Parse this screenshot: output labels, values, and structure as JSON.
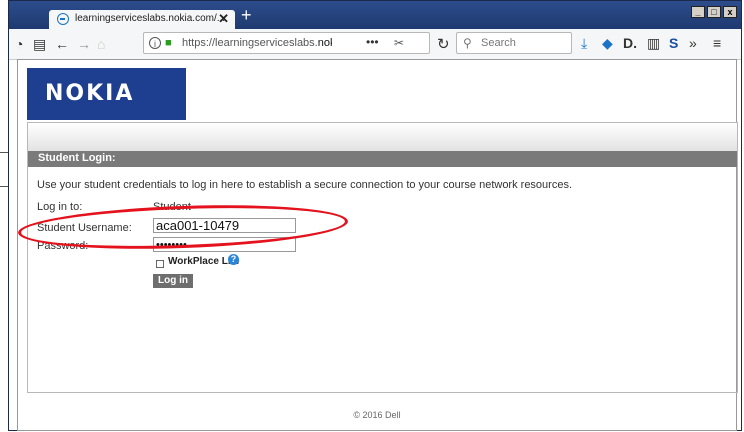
{
  "browser": {
    "tab_title": "learningserviceslabs.nokia.com/...",
    "tab_close": "✕",
    "new_tab": "+",
    "url_prefix": "https://learningserviceslabs.",
    "url_domain": "nokia.com",
    "url_more": "•••",
    "search_placeholder": "Search",
    "window_buttons": [
      "_",
      "□",
      "x"
    ]
  },
  "toolbar_icons": [
    "identity-icon",
    "print-icon",
    "back-icon",
    "forward-icon",
    "home-icon",
    "reload-icon",
    "download-icon",
    "notification-icon",
    "extension-icon",
    "sidebar-icon",
    "s-icon",
    "overflow-icon",
    "menu-icon"
  ],
  "page": {
    "logo": "NOKIA",
    "section_title": "Student Login:",
    "description": "Use your student credentials to log in here to establish a secure connection to your course network resources.",
    "log_in_to_label": "Log in to:",
    "log_in_to_value": "Student",
    "username_label": "Student Username:",
    "username_value": "aca001-10479",
    "password_label": "Password:",
    "password_value": "••••••••",
    "workplace_lite": "WorkPlace Lite",
    "login_button": "Log in",
    "footer": "© 2016 Dell"
  },
  "colors": {
    "annotation": "#e4121c",
    "logo_bg": "#1e3f8f",
    "header_bar": "#7a7a7a"
  }
}
